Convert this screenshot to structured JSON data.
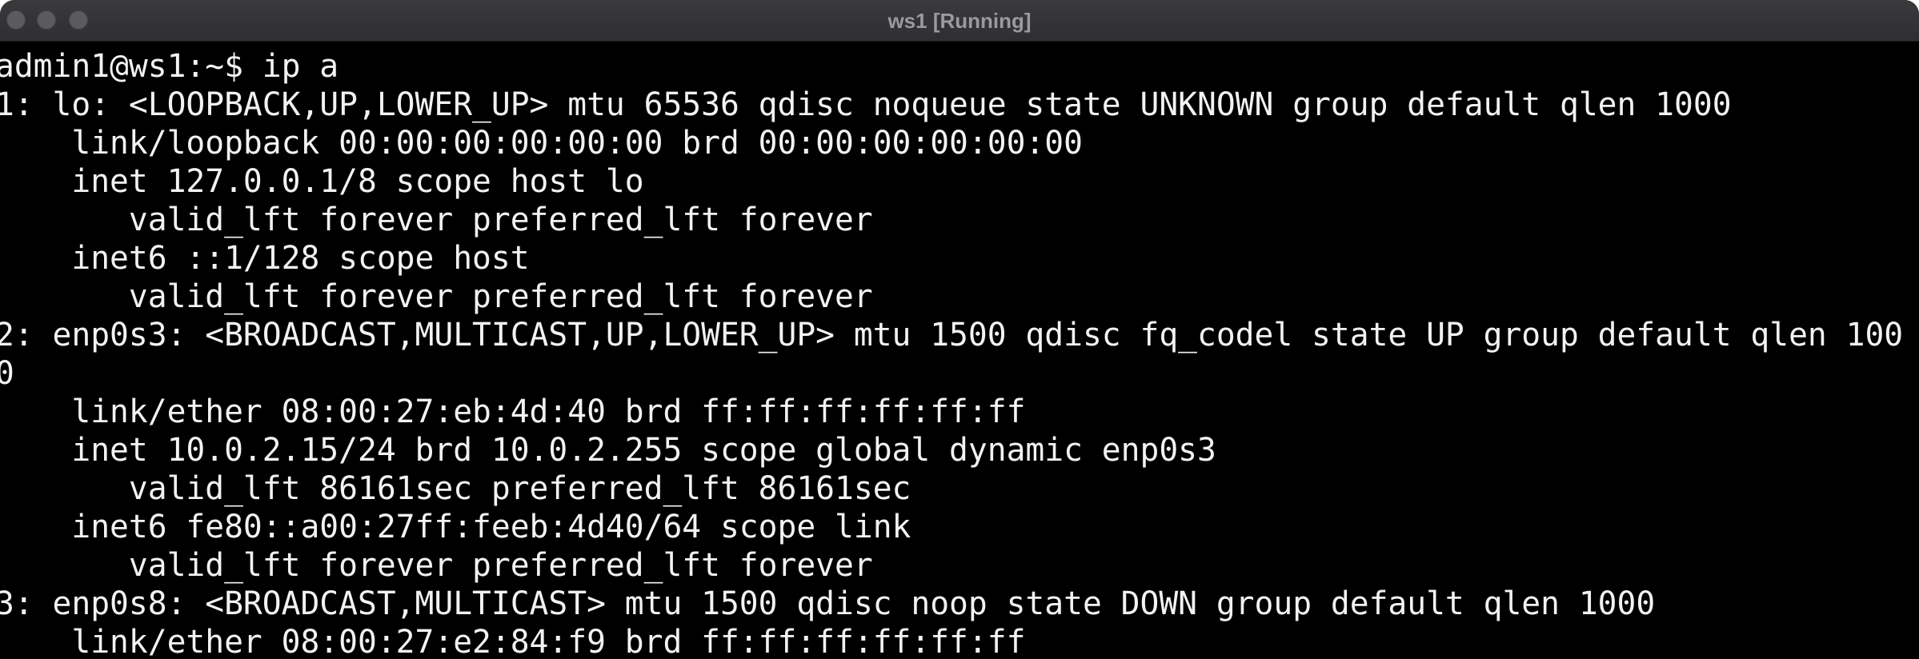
{
  "window": {
    "title": "ws1 [Running]",
    "controls": [
      "close",
      "minimize",
      "zoom"
    ]
  },
  "terminal": {
    "lines": [
      "admin1@ws1:~$ ip a",
      "1: lo: <LOOPBACK,UP,LOWER_UP> mtu 65536 qdisc noqueue state UNKNOWN group default qlen 1000",
      "    link/loopback 00:00:00:00:00:00 brd 00:00:00:00:00:00",
      "    inet 127.0.0.1/8 scope host lo",
      "       valid_lft forever preferred_lft forever",
      "    inet6 ::1/128 scope host",
      "       valid_lft forever preferred_lft forever",
      "2: enp0s3: <BROADCAST,MULTICAST,UP,LOWER_UP> mtu 1500 qdisc fq_codel state UP group default qlen 100",
      "0",
      "    link/ether 08:00:27:eb:4d:40 brd ff:ff:ff:ff:ff:ff",
      "    inet 10.0.2.15/24 brd 10.0.2.255 scope global dynamic enp0s3",
      "       valid_lft 86161sec preferred_lft 86161sec",
      "    inet6 fe80::a00:27ff:feeb:4d40/64 scope link",
      "       valid_lft forever preferred_lft forever",
      "3: enp0s8: <BROADCAST,MULTICAST> mtu 1500 qdisc noop state DOWN group default qlen 1000",
      "    link/ether 08:00:27:e2:84:f9 brd ff:ff:ff:ff:ff:ff"
    ]
  },
  "colors": {
    "background": "#000000",
    "text": "#f2f2f2",
    "titlebar": "#3a3a3c",
    "title_text": "#9b9b9e",
    "traffic_light": "#5b5b5e"
  }
}
